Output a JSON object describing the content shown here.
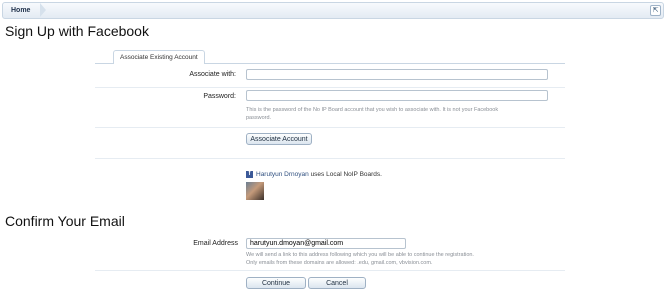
{
  "breadcrumb": {
    "home": "Home",
    "tool_icon": "expand-icon"
  },
  "signup": {
    "title": "Sign Up with Facebook",
    "tab": "Associate Existing Account",
    "associate_label": "Associate with:",
    "associate_value": "",
    "password_label": "Password:",
    "password_value": "",
    "password_hint_1": "This is the password of the No IP Board account that you wish to associate with. It is not your Facebook",
    "password_hint_2": "password.",
    "associate_button": "Associate Account",
    "fb_user": "Harutyun Drnoyan",
    "fb_suffix": "uses Local NoIP Boards."
  },
  "confirm": {
    "title": "Confirm Your Email",
    "email_label": "Email Address",
    "email_value": "harutyun.dmoyan@gmail.com",
    "hint_1": "We will send a link to this address following which you will be able to continue the registration.",
    "hint_2": "Only emails from these domains are allowed: .edu, gmail.com, vbvision.com.",
    "continue_button": "Continue",
    "cancel_button": "Cancel"
  }
}
